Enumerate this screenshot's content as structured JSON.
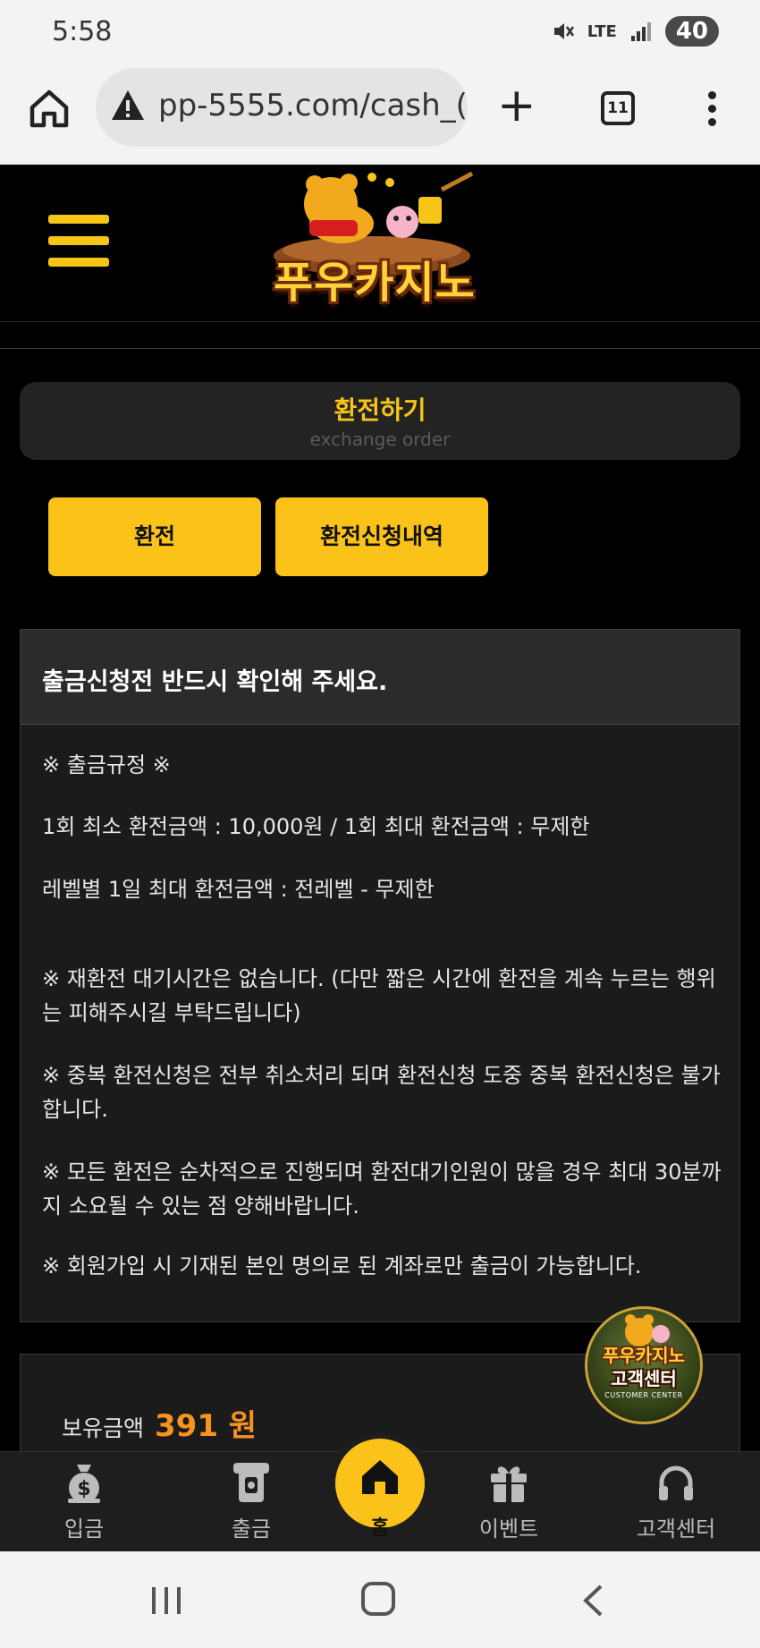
{
  "status_bar": {
    "time": "5:58",
    "network": "LTE",
    "battery": "40"
  },
  "browser": {
    "url": "pp-5555.com/cash_(",
    "tab_count": "11"
  },
  "site": {
    "logo_text": "푸우카지노"
  },
  "page": {
    "title": "환전하기",
    "subtitle": "exchange order"
  },
  "tabs": [
    {
      "label": "환전"
    },
    {
      "label": "환전신청내역"
    }
  ],
  "notice": {
    "heading": "출금신청전 반드시 확인해 주세요.",
    "lines": [
      "※ 출금규정 ※",
      "1회 최소 환전금액 : 10,000원 / 1회 최대 환전금액 : 무제한",
      "레벨별 1일 최대 환전금액 : 전레벨 - 무제한",
      "※ 재환전 대기시간은 없습니다. (다만 짧은 시간에 환전을 계속 누르는 행위는 피해주시길 부탁드립니다)",
      "※ 중복 환전신청은 전부 취소처리 되며 환전신청 도중 중복 환전신청은 불가합니다.",
      "※ 모든 환전은 순차적으로 진행되며 환전대기인원이 많을 경우 최대 30분까지 소요될 수 있는 점 양해바랍니다.",
      "※ 회원가입 시 기재된 본인 명의로 된 계좌로만 출금이 가능합니다."
    ]
  },
  "balance": {
    "label": "보유금액",
    "value": "391 원"
  },
  "customer_center_badge": {
    "logo": "푸우카지노",
    "title": "고객센터",
    "subtitle": "CUSTOMER CENTER"
  },
  "bottom_nav": [
    {
      "label": "입금",
      "icon": "money-bag-icon"
    },
    {
      "label": "출금",
      "icon": "atm-icon"
    },
    {
      "label": "홈",
      "icon": "home-icon"
    },
    {
      "label": "이벤트",
      "icon": "gift-icon"
    },
    {
      "label": "고객센터",
      "icon": "headset-icon"
    }
  ],
  "colors": {
    "accent": "#fbc319",
    "balance": "#f7931e",
    "background": "#000000"
  }
}
